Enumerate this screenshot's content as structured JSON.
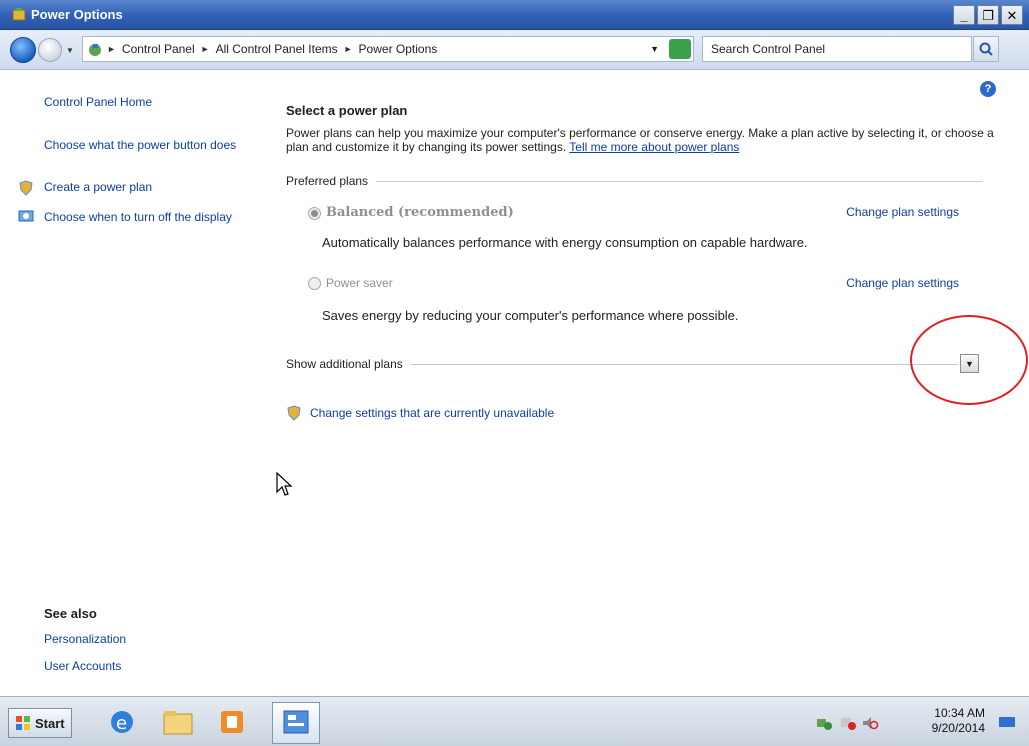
{
  "window": {
    "title": "Power Options"
  },
  "address": {
    "crumbs": [
      "Control Panel",
      "All Control Panel Items",
      "Power Options"
    ],
    "search_placeholder": "Search Control Panel"
  },
  "sidebar": {
    "home": "Control Panel Home",
    "links": [
      {
        "label": "Choose what the power button does"
      },
      {
        "label": "Create a power plan"
      },
      {
        "label": "Choose when to turn off the display"
      }
    ],
    "see_also_header": "See also",
    "see_also": [
      "Personalization",
      "User Accounts"
    ]
  },
  "main": {
    "title": "Select a power plan",
    "description": "Power plans can help you maximize your computer's performance or conserve energy. Make a plan active by selecting it, or choose a plan and customize it by changing its power settings.",
    "learn_more": "Tell me more about power plans",
    "preferred_header": "Preferred plans",
    "plans": [
      {
        "name": "Balanced (recommended)",
        "description": "Automatically balances performance with energy consumption on capable hardware.",
        "change": "Change plan settings",
        "selected": true
      },
      {
        "name": "Power saver",
        "description": "Saves energy by reducing your computer's performance where possible.",
        "change": "Change plan settings",
        "selected": false
      }
    ],
    "additional_header": "Show additional plans",
    "unavailable_link": "Change settings that are currently unavailable"
  },
  "taskbar": {
    "start_label": "Start",
    "time": "10:34 AM",
    "date": "9/20/2014"
  },
  "colors": {
    "link": "#0d3f9f",
    "titlebar": "#2f5fb6",
    "annotation": "#dd2222"
  }
}
